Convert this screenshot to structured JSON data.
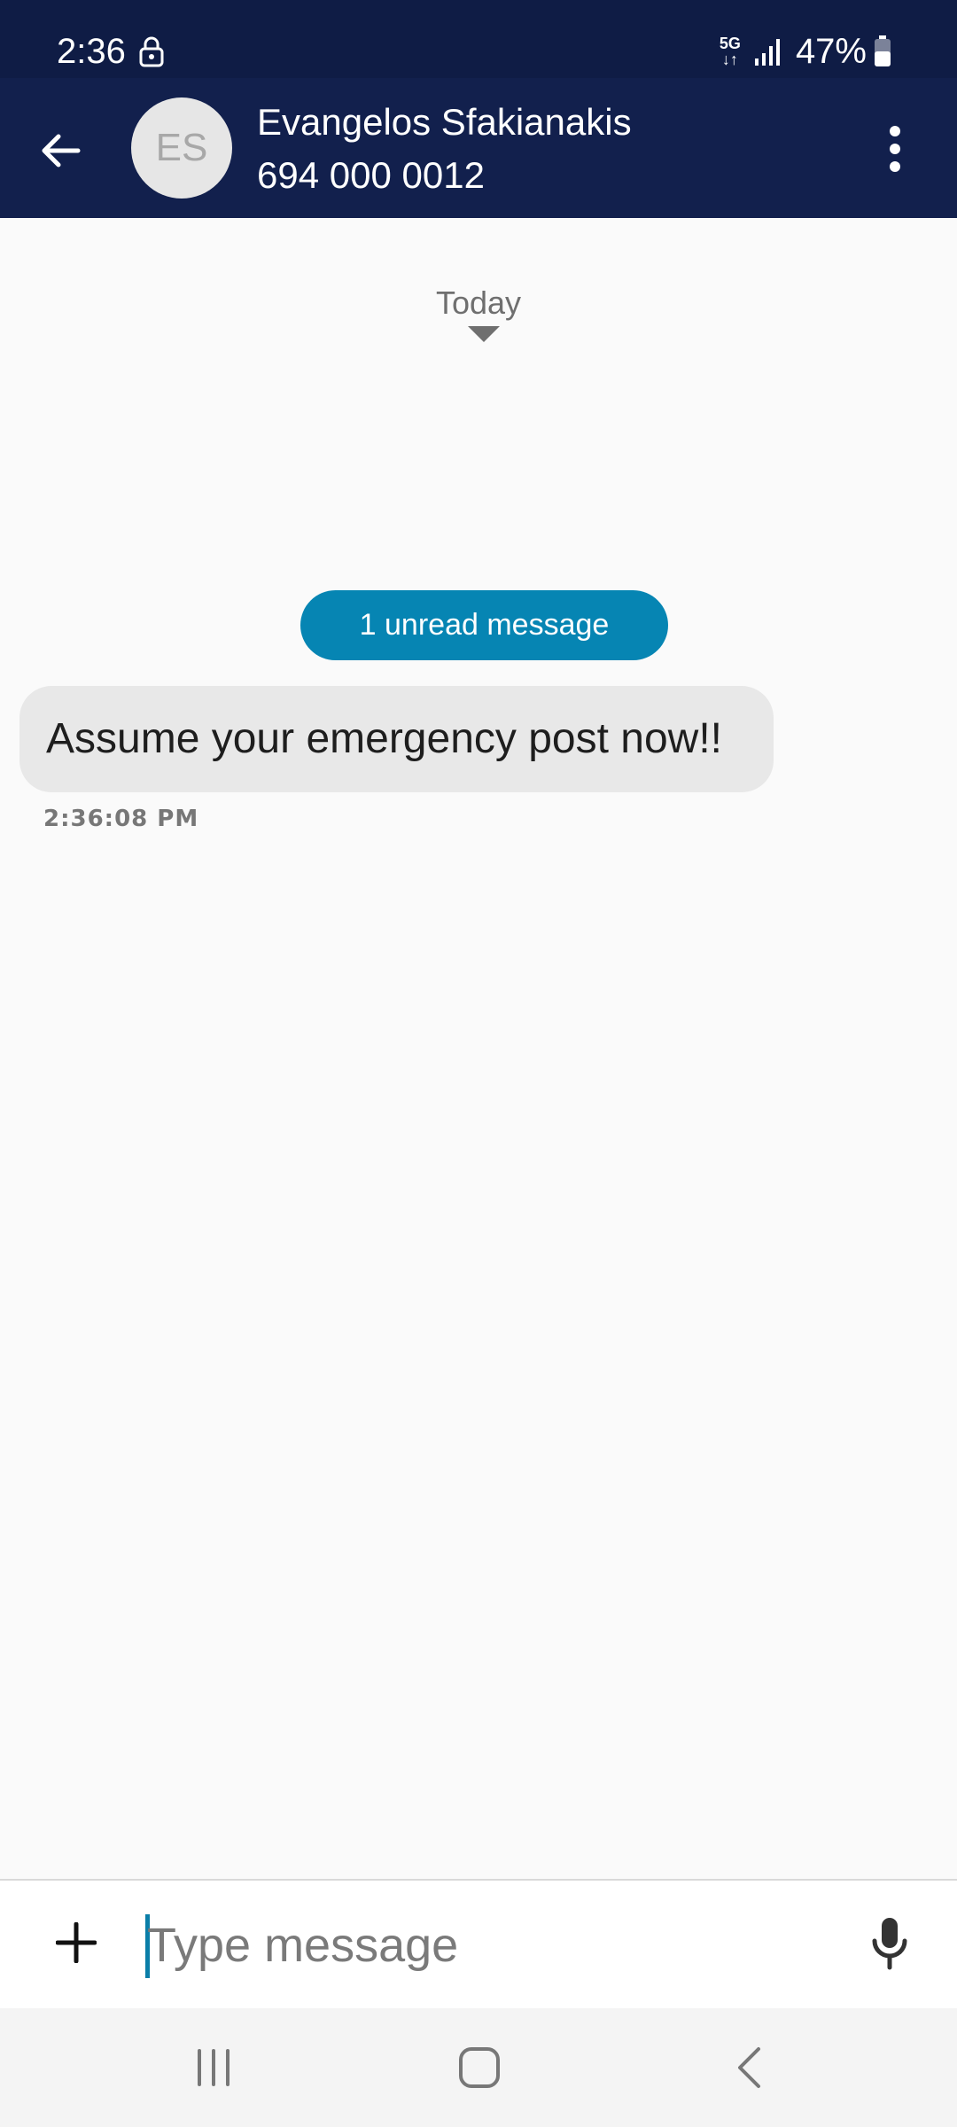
{
  "status_bar": {
    "time": "2:36",
    "network": "5G",
    "battery": "47%",
    "icons": [
      "lock-icon",
      "signal-icon",
      "battery-icon"
    ]
  },
  "header": {
    "avatar_initials": "ES",
    "contact_name": "Evangelos Sfakianakis",
    "contact_number": "694 000 0012",
    "icons": [
      "back-arrow-icon",
      "more-vert-icon"
    ]
  },
  "conversation": {
    "date_separator": "Today",
    "unread_label": "1 unread message",
    "messages": [
      {
        "text": "Assume your emergency post now!!",
        "time": "2:36:08 PM"
      }
    ]
  },
  "composer": {
    "placeholder": "Type message",
    "value": "",
    "icons": [
      "plus-icon",
      "mic-icon"
    ]
  },
  "nav_bar": {
    "icons": [
      "recents-icon",
      "home-icon",
      "back-icon"
    ]
  },
  "colors": {
    "status_bar_bg": "#0f1c45",
    "app_bar_bg": "#12204d",
    "unread_pill": "#0685b3",
    "bubble_bg": "#e8e8e8",
    "cursor": "#0a7ea8"
  }
}
